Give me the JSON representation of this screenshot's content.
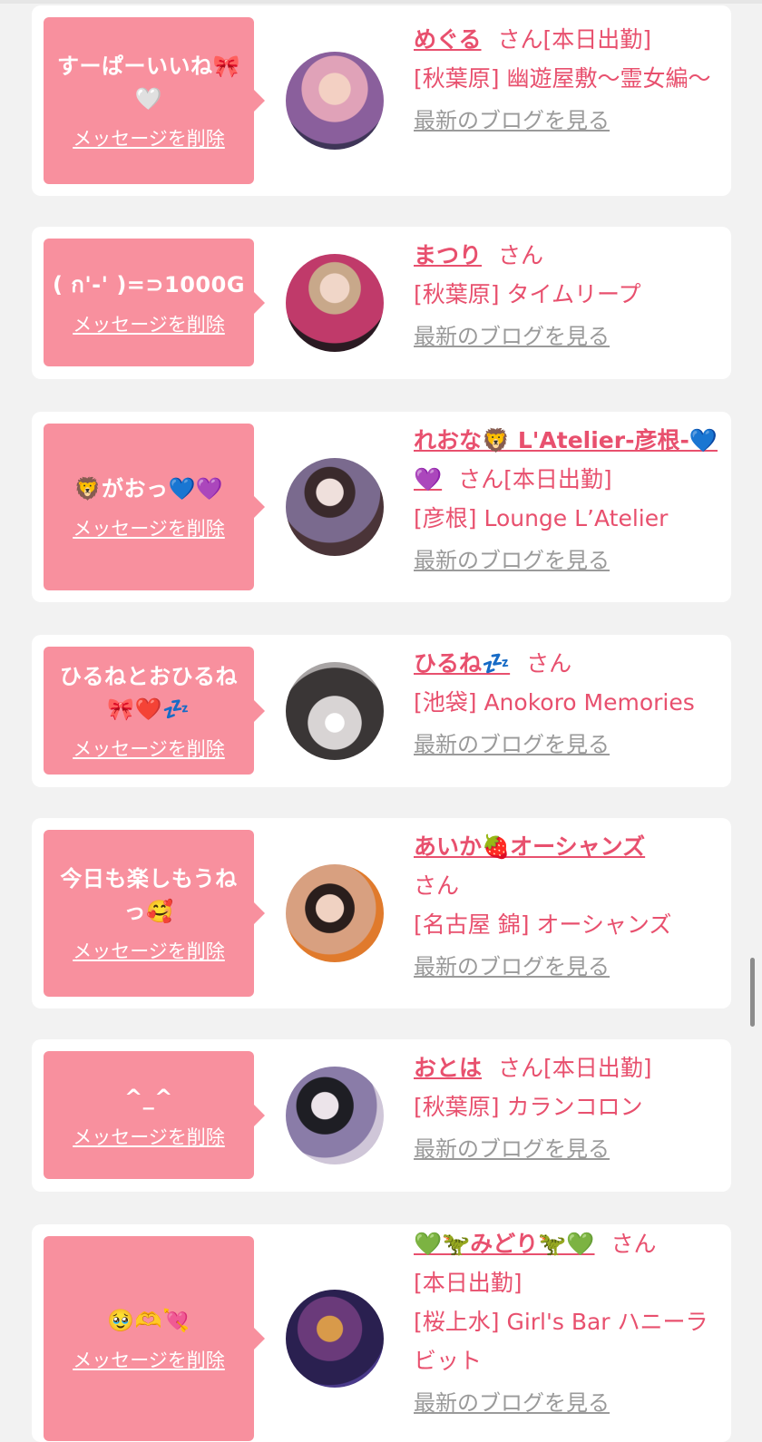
{
  "delete_label": "メッセージを削除",
  "blog_label": "最新のブログを見る",
  "san_label": "さん",
  "colors": {
    "accent": "#e8506e",
    "bubble": "#f8909e",
    "background": "#f2f2f2"
  },
  "items": [
    {
      "message": "すーぱーいいね🎀🤍",
      "name": "めぐる",
      "status": "[本日出勤]",
      "shop": "[秋葉原] 幽遊屋敷〜霊女編〜"
    },
    {
      "message": "( ก'-' )=⊃1000G",
      "name": "まつり",
      "status": "",
      "shop": "[秋葉原] タイムリープ"
    },
    {
      "message": "🦁がおっ💙💜",
      "name": "れおな🦁 L'Atelier-彦根-💙💜",
      "status": "[本日出勤]",
      "shop": "[彦根] Lounge L’Atelier"
    },
    {
      "message": "ひるねとおひるね🎀❤️💤",
      "name": "ひるね💤",
      "status": "",
      "shop": "[池袋] Anokoro Memories"
    },
    {
      "message": "今日も楽しもうねっ🥰",
      "name": "あいか🍓オーシャンズ",
      "status": "",
      "shop": "[名古屋 錦] オーシャンズ"
    },
    {
      "message": "^_^",
      "name": "おとは",
      "status": "[本日出勤]",
      "shop": "[秋葉原] カランコロン"
    },
    {
      "message": "🥹🫶💘",
      "name": "💚🦖みどり🦖💚",
      "status": "[本日出勤]",
      "shop": "[桜上水] Girl's Bar ハニーラビット"
    }
  ]
}
